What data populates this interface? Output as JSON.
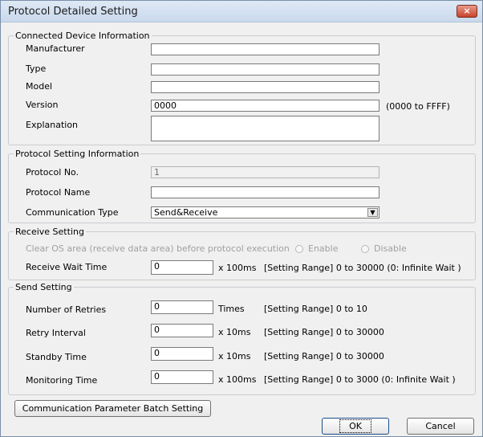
{
  "window": {
    "title": "Protocol Detailed Setting",
    "close_icon": "×"
  },
  "connected": {
    "legend": "Connected Device Information",
    "manufacturer_label": "Manufacturer",
    "type_label": "Type",
    "model_label": "Model",
    "version_label": "Version",
    "version_value": "0000",
    "version_range": "(0000 to FFFF)",
    "explanation_label": "Explanation"
  },
  "protocol": {
    "legend": "Protocol Setting Information",
    "no_label": "Protocol No.",
    "no_value": "1",
    "name_label": "Protocol Name",
    "comm_type_label": "Communication Type",
    "comm_type_value": "Send&Receive"
  },
  "receive": {
    "legend": "Receive Setting",
    "clear_label": "Clear OS area (receive data area) before protocol execution",
    "enable_label": "Enable",
    "disable_label": "Disable",
    "wait_label": "Receive Wait Time",
    "wait_value": "0",
    "wait_unit": "x 100ms",
    "wait_range": "[Setting Range] 0 to 30000 (0: Infinite Wait )"
  },
  "send": {
    "legend": "Send Setting",
    "retries_label": "Number of Retries",
    "retries_value": "0",
    "retries_unit": "Times",
    "retries_range": "[Setting Range] 0 to 10",
    "interval_label": "Retry Interval",
    "interval_value": "0",
    "interval_unit": "x 10ms",
    "interval_range": "[Setting Range] 0 to 30000",
    "standby_label": "Standby Time",
    "standby_value": "0",
    "standby_unit": "x 10ms",
    "standby_range": "[Setting Range] 0 to 30000",
    "monitor_label": "Monitoring Time",
    "monitor_value": "0",
    "monitor_unit": "x 100ms",
    "monitor_range": "[Setting Range] 0 to 3000 (0: Infinite Wait )"
  },
  "buttons": {
    "batch_label": "Communication Parameter Batch Setting",
    "ok_label": "OK",
    "cancel_label": "Cancel"
  }
}
